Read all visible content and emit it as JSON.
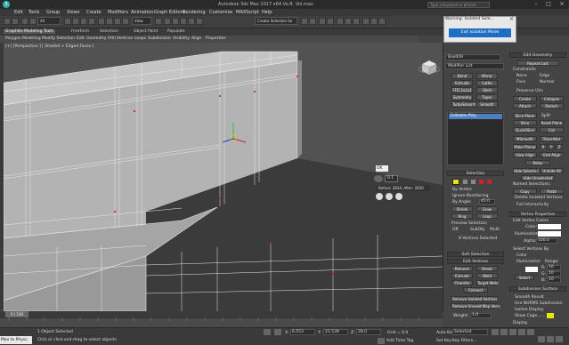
{
  "titlebar": {
    "app_logo": "3",
    "title": "Autodesk 3ds Max 2017 x64    Vo.B.  Vol.max",
    "search_placeholder": "Type a keyword or phrase",
    "minimize": "–",
    "maximize": "□",
    "close": "×"
  },
  "menubar": {
    "items": [
      "Edit",
      "Tools",
      "Group",
      "Views",
      "Create",
      "Modifiers",
      "Animation",
      "Graph Editors",
      "Rendering",
      "Customize",
      "MAXScript",
      "Help"
    ]
  },
  "toolbar": {
    "filter_dropdown": "All",
    "view_dropdown": "View",
    "selection_set": "Create Selection Se"
  },
  "ribbon": {
    "tabs": [
      "Graphite Modeling Tools",
      "Freeform",
      "Selection",
      "Object Paint",
      "Populate"
    ],
    "subtabs": [
      "Polygon Modeling",
      "Modify Selection",
      "Edit",
      "Geometry (All)",
      "Vertices",
      "Loops",
      "Subdivision",
      "Visibility",
      "Align",
      "Properties"
    ]
  },
  "viewport": {
    "label": "[+] [Perspective ] [ Shaded + Edged Faces ]",
    "ok_label": "OK",
    "weld_value": "0.1",
    "weld_info": "Before: 2834, After: 2830"
  },
  "dialog": {
    "title": "Warning: Isolated Sele...",
    "close": "×",
    "button": "Exit Isolation Mode"
  },
  "command_panel": {
    "object_name": "Box009",
    "modifier_list": "Modifier List",
    "modifier_buttons": [
      "Bend",
      "Mirror",
      "Extrude",
      "Lathe",
      "FFD 2x2x2",
      "Shell",
      "Symmetry",
      "Taper",
      "TurboSmooth",
      "Smooth"
    ],
    "stack_item": "Editable Poly",
    "selection_header": "Selection",
    "by_vertex": "By Vertex",
    "ignore_backfacing": "Ignore Backfacing",
    "by_angle": "By Angle:",
    "by_angle_value": "45.0",
    "shrink": "Shrink",
    "grow": "Grow",
    "ring": "Ring",
    "loop": "Loop",
    "preview_selection": "Preview Selection",
    "preview_off": "Off",
    "preview_subobj": "SubObj",
    "preview_multi": "Multi",
    "selection_status": "8 Vertices Selected",
    "soft_selection": "Soft Selection",
    "edit_vertices": "Edit Vertices",
    "remove": "Remove",
    "break": "Break",
    "extrude": "Extrude",
    "weld": "Weld",
    "chamfer": "Chamfer",
    "target_weld": "Target Weld",
    "connect": "Connect",
    "remove_isolated": "Remove Isolated Vertices",
    "remove_unused_map": "Remove Unused Map Verts",
    "weight_label": "Weight:",
    "weight_value": "1.0",
    "edit_geometry": "Edit Geometry",
    "repeat_last": "Repeat Last",
    "constraints": "Constraints",
    "c_none": "None",
    "c_edge": "Edge",
    "c_face": "Face",
    "c_normal": "Normal",
    "preserve_uvs": "Preserve UVs",
    "create": "Create",
    "collapse": "Collapse",
    "attach": "Attach",
    "detach": "Detach",
    "slice_plane": "Slice Plane",
    "split": "Split",
    "slice": "Slice",
    "reset_plane": "Reset Plane",
    "quickslice": "QuickSlice",
    "cut": "Cut",
    "msmooth": "MSmooth",
    "tessellate": "Tessellate",
    "make_planar": "Make Planar",
    "x": "X",
    "y": "Y",
    "z": "Z",
    "view_align": "View Align",
    "grid_align": "Grid Align",
    "relax": "Relax",
    "hide_selected": "Hide Selected",
    "unhide_all": "Unhide All",
    "hide_unselected": "Hide Unselected",
    "named_selections": "Named Selections:",
    "copy": "Copy",
    "paste": "Paste",
    "delete_isolated": "Delete Isolated Vertices",
    "full_interactivity": "Full Interactivity",
    "vertex_properties": "Vertex Properties",
    "edit_vertex_colors": "Edit Vertex Colors",
    "color_label": "Color:",
    "illumination_label": "Illumination:",
    "alpha_label": "Alpha:",
    "alpha_value": "100.0",
    "select_vertices_by": "Select Vertices By",
    "sv_color": "Color",
    "sv_illumination": "Illumination",
    "range_label": "Range:",
    "range_r": "R:",
    "range_g": "G:",
    "range_b": "B:",
    "range_r_value": "10",
    "range_g_value": "10",
    "range_b_value": "10",
    "select_button": "Select",
    "subdivision_surface": "Subdivision Surface",
    "smooth_result": "Smooth Result",
    "use_nurms": "Use NURMS Subdivision",
    "isoline_display": "Isoline Display",
    "show_cage": "Show Cage......",
    "display_label": "Display"
  },
  "timeline": {
    "frame_display": "0 / 100"
  },
  "status": {
    "maxscript": "Max to Physc.",
    "selection": "1 Object Selected",
    "prompt": "Click or click-and-drag to select objects",
    "x_label": "X:",
    "x_value": "6.553",
    "y_label": "Y:",
    "y_value": "21.539",
    "z_label": "Z:",
    "z_value": "28.0",
    "grid": "Grid = 0.0",
    "add_time_tag": "Add Time Tag",
    "auto_key": "Auto Key",
    "selected_dropdown": "Selected",
    "set_key": "Set Key",
    "key_filters": "Key Filters..."
  },
  "colors": {
    "accent": "#1e6ec4",
    "viewport_bg": "#525252",
    "mesh": "#b8b8b8",
    "mesh_shade": "#9a9a9a",
    "wire": "#e8e8e8",
    "vertex": "#e01010",
    "dark_panel": "#444444",
    "highlight_slot": "#e6e600",
    "red_slot": "#cc2222"
  }
}
